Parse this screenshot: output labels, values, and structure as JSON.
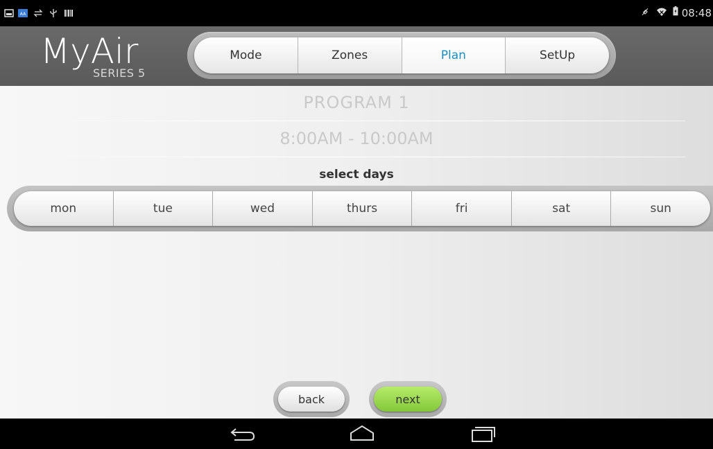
{
  "status_bar": {
    "time": "08:48",
    "left_icons": [
      "image-icon",
      "app-icon",
      "sync-icon",
      "usb-icon",
      "barcode-icon"
    ],
    "right_icons": [
      "mute-icon",
      "wifi-icon",
      "battery-icon"
    ]
  },
  "header": {
    "logo": "MyAir",
    "logo_sub": "SERIES 5",
    "tabs": [
      {
        "label": "Mode",
        "active": false
      },
      {
        "label": "Zones",
        "active": false
      },
      {
        "label": "Plan",
        "active": true
      },
      {
        "label": "SetUp",
        "active": false
      }
    ]
  },
  "program": {
    "title": "PROGRAM 1",
    "time_range": "8:00AM - 10:00AM"
  },
  "days": {
    "heading": "select days",
    "items": [
      "mon",
      "tue",
      "wed",
      "thurs",
      "fri",
      "sat",
      "sun"
    ]
  },
  "buttons": {
    "back": "back",
    "next": "next"
  },
  "colors": {
    "accent": "#1a8fc3",
    "next_green": "#9cdc50",
    "header_bg": "#5e5e5e"
  }
}
